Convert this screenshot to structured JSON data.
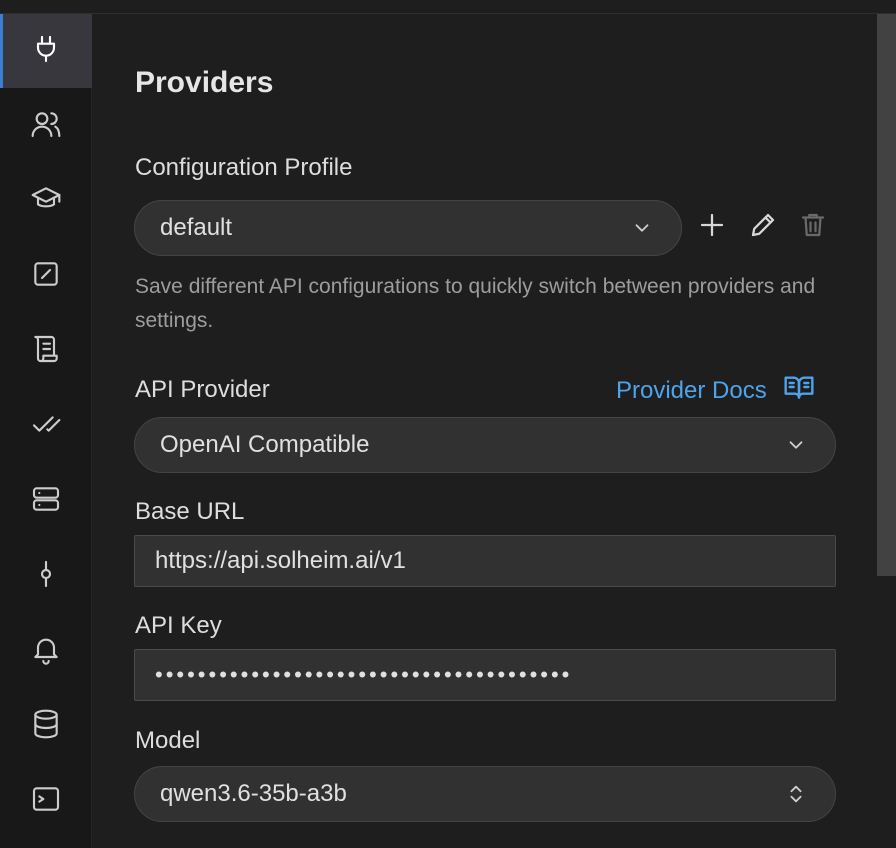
{
  "sidebar": {
    "items": [
      {
        "name": "providers",
        "icon": "plug-icon",
        "active": true
      },
      {
        "name": "users",
        "icon": "users-icon"
      },
      {
        "name": "education",
        "icon": "graduation-cap-icon"
      },
      {
        "name": "edit",
        "icon": "square-pen-icon"
      },
      {
        "name": "scroll",
        "icon": "scroll-icon"
      },
      {
        "name": "checks",
        "icon": "check-check-icon"
      },
      {
        "name": "server",
        "icon": "server-icon"
      },
      {
        "name": "git-commit",
        "icon": "git-commit-icon"
      },
      {
        "name": "notifications",
        "icon": "bell-icon"
      },
      {
        "name": "database",
        "icon": "database-icon"
      },
      {
        "name": "terminal",
        "icon": "terminal-icon"
      }
    ]
  },
  "page": {
    "title": "Providers"
  },
  "profile": {
    "label": "Configuration Profile",
    "selected": "default",
    "description": "Save different API configurations to quickly switch between providers and settings."
  },
  "provider": {
    "label": "API Provider",
    "docs_link": "Provider Docs",
    "selected": "OpenAI Compatible"
  },
  "base_url": {
    "label": "Base URL",
    "value": "https://api.solheim.ai/v1"
  },
  "api_key": {
    "label": "API Key",
    "value": "•••••••••••••••••••••••••••••••••••••••"
  },
  "model": {
    "label": "Model",
    "selected": "qwen3.6-35b-a3b"
  },
  "colors": {
    "accent": "#4fa3ec",
    "active_indicator": "#3c7fd1",
    "background": "#1e1e1e",
    "input_bg": "#313131"
  }
}
